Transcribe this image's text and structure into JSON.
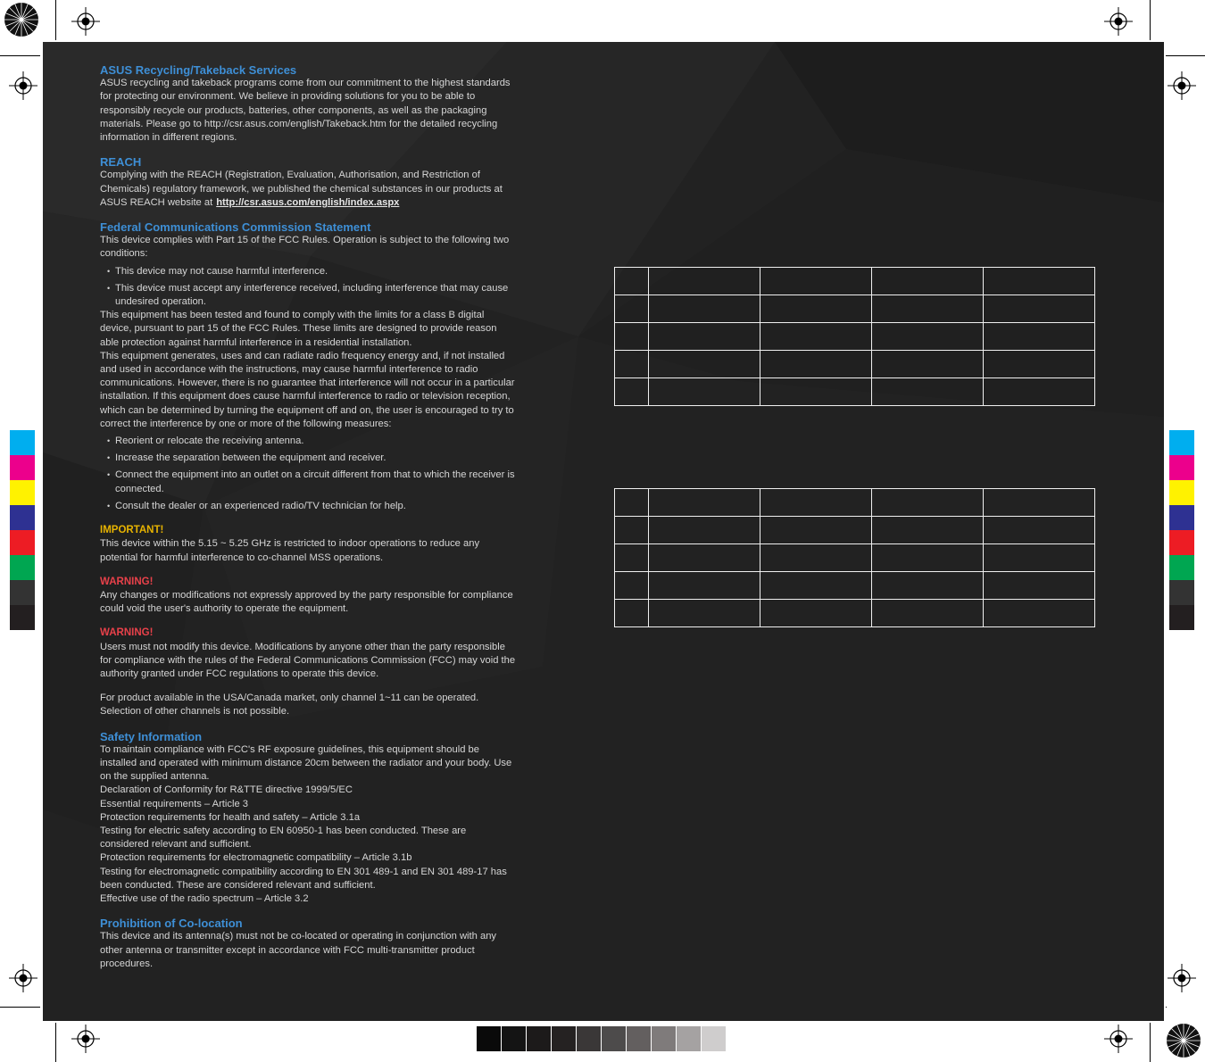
{
  "recycling": {
    "heading": "ASUS Recycling/Takeback Services",
    "body": "ASUS recycling and takeback programs come from our commitment to the highest standards for protecting our environment. We believe in providing solutions for you to be able to responsibly recycle our products, batteries, other components, as well as the packaging materials. Please go to http://csr.asus.com/english/Takeback.htm for the detailed recycling information in different regions."
  },
  "reach": {
    "heading": "REACH",
    "body": "Complying with the REACH (Registration, Evaluation, Authorisation, and Restriction of Chemicals) regulatory framework, we published the chemical substances in our products at ASUS REACH website at",
    "link": "http://csr.asus.com/english/index.aspx"
  },
  "fcc": {
    "heading": "Federal Communications Commission Statement",
    "intro": "This device complies with Part 15 of the FCC Rules. Operation is subject to the following two conditions:",
    "conditions": [
      "This device may not cause harmful interference.",
      "This device must accept any interference received, including interference that may cause undesired operation."
    ],
    "para1": "This equipment has been tested and found to comply with the limits for a class B digital device, pursuant to part 15 of the FCC Rules. These limits are designed to provide reason able protection against harmful interference in a residential installation.",
    "para2": "This equipment generates, uses and can radiate radio frequency energy and, if not installed and used in accordance with the instructions, may cause harmful interference to radio communications. However, there is no guarantee that interference will not occur in a particular installation. If this equipment does cause harmful interference to radio or television reception, which can be determined by turning the equipment off and on, the user is encouraged to try to correct the interference by one or more of the following measures:",
    "measures": [
      "Reorient or relocate the receiving antenna.",
      "Increase the separation between the equipment and receiver.",
      "Connect the equipment into an outlet on a circuit different from that to which the receiver is connected.",
      "Consult the dealer or an experienced radio/TV technician for help."
    ]
  },
  "important": {
    "label": "IMPORTANT!",
    "body": "This device within the 5.15 ~ 5.25 GHz is restricted to indoor operations to reduce any potential for harmful interference to co-channel MSS operations."
  },
  "warning1": {
    "label": "WARNING!",
    "body": "Any changes or modifications not expressly approved by the party responsible for compliance could void the user's authority to operate the equipment."
  },
  "warning2": {
    "label": "WARNING!",
    "body": "Users must not modify this device. Modifications by anyone other than the party responsible for compliance with the rules of the Federal Communications Commission (FCC) may void the authority granted under FCC regulations to operate this device.",
    "channels": "For product available in the USA/Canada market, only channel 1~11 can be operated. Selection of other channels is not possible."
  },
  "safety": {
    "heading": "Safety Information",
    "lines": [
      "To maintain compliance with FCC's RF exposure guidelines, this equipment should be installed and operated with minimum distance 20cm between the radiator and your body. Use on the supplied antenna.",
      "Declaration of Conformity for R&TTE directive 1999/5/EC",
      "Essential requirements – Article 3",
      "Protection requirements for health and safety – Article 3.1a",
      "Testing for electric safety according to EN 60950-1 has been conducted. These are considered relevant and sufficient.",
      "Protection requirements for electromagnetic compatibility – Article 3.1b",
      "Testing for electromagnetic compatibility according to EN 301 489-1 and EN 301 489-17 has been conducted. These are considered relevant and sufficient.",
      "Effective use of the radio spectrum – Article 3.2"
    ]
  },
  "colocation": {
    "heading": "Prohibition of Co-location",
    "body": "This device and its antenna(s) must not be co-located or operating in conjunction with any other antenna or transmitter except in accordance with FCC multi-transmitter product procedures."
  },
  "colors": {
    "page": "#222222",
    "heading_blue": "#3e8fd6",
    "important": "#e7b300",
    "warning": "#e8414a",
    "cmyk_bar": [
      "#00aeef",
      "#ec008c",
      "#fff200",
      "#2e3192",
      "#ed1c24",
      "#00a651",
      "#333333",
      "#231f20"
    ],
    "gray_bar": [
      "#0a0a0a",
      "#141414",
      "#1c1a1a",
      "#252222",
      "#3a3737",
      "#4d4b4b",
      "#635f5f",
      "#7f7b7b",
      "#a5a2a2",
      "#cfcdcd"
    ]
  }
}
